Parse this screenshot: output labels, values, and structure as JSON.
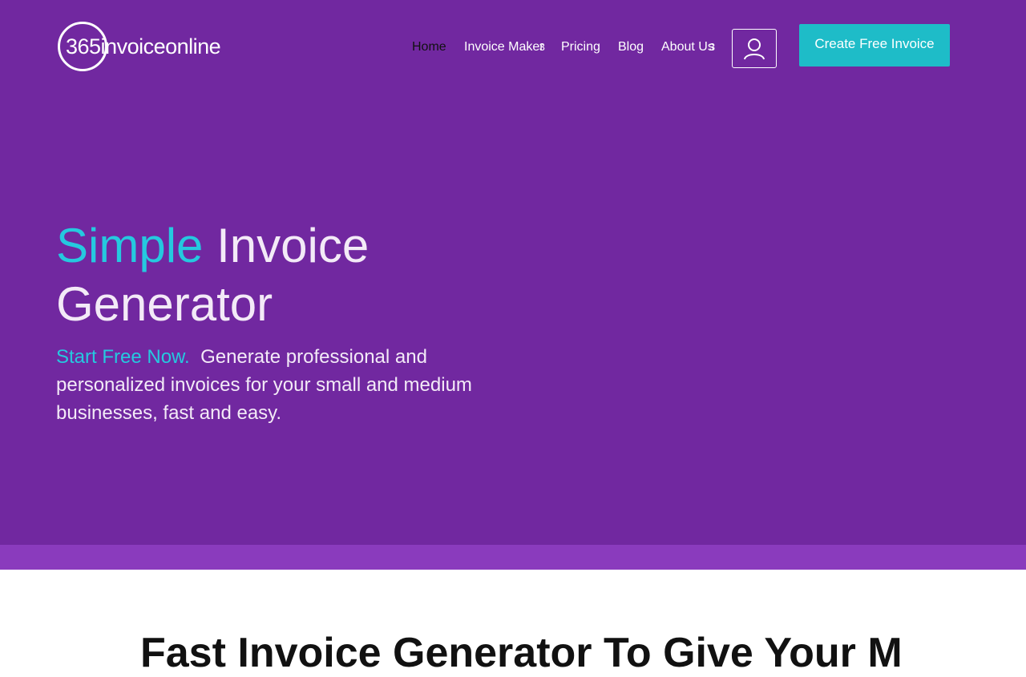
{
  "logo": {
    "text": "365invoiceonline"
  },
  "nav": {
    "items": [
      {
        "label": "Home",
        "active": true
      },
      {
        "label": "Invoice Maker",
        "has_dropdown": true
      },
      {
        "label": "Pricing"
      },
      {
        "label": "Blog"
      },
      {
        "label": "About Us",
        "has_dropdown": true
      }
    ],
    "dropdown_caret": "3"
  },
  "user_button": {
    "icon": "user-icon"
  },
  "cta": {
    "label": "Create Free Invoice"
  },
  "hero": {
    "headline_accent": "Simple",
    "headline_rest": " Invoice Generator",
    "sub_accent": "Start Free Now.",
    "sub_text": "  Generate professional and personalized invoices for your small and medium businesses, fast and easy."
  },
  "next_section": {
    "heading": "Fast Invoice Generator To Give Your M"
  },
  "colors": {
    "hero_bg": "#7128a0",
    "band_bg": "#8a3bbd",
    "accent": "#25c9df",
    "cta_bg": "#1ebcc8"
  }
}
